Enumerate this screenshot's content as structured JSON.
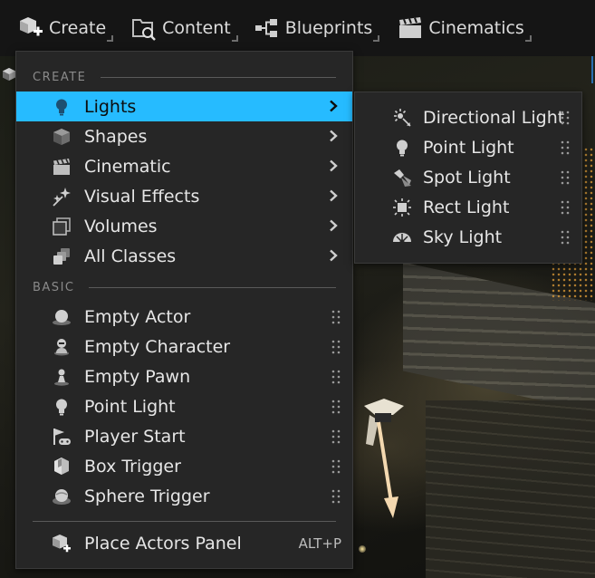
{
  "toolbar": {
    "items": [
      {
        "label": "Create",
        "icon": "create-actor-icon"
      },
      {
        "label": "Content",
        "icon": "content-browser-icon"
      },
      {
        "label": "Blueprints",
        "icon": "blueprints-icon"
      },
      {
        "label": "Cinematics",
        "icon": "clapperboard-icon"
      }
    ]
  },
  "menu": {
    "create_header": "CREATE",
    "basic_header": "BASIC",
    "create_items": [
      {
        "label": "Lights",
        "icon": "lightbulb-icon",
        "active": true
      },
      {
        "label": "Shapes",
        "icon": "cube-icon"
      },
      {
        "label": "Cinematic",
        "icon": "clapperboard-icon"
      },
      {
        "label": "Visual Effects",
        "icon": "sparkles-icon"
      },
      {
        "label": "Volumes",
        "icon": "volume-box-icon"
      },
      {
        "label": "All Classes",
        "icon": "stacked-classes-icon"
      }
    ],
    "basic_items": [
      {
        "label": "Empty Actor",
        "icon": "sphere-actor-icon"
      },
      {
        "label": "Empty Character",
        "icon": "character-icon"
      },
      {
        "label": "Empty Pawn",
        "icon": "pawn-icon"
      },
      {
        "label": "Point Light",
        "icon": "lightbulb-icon"
      },
      {
        "label": "Player Start",
        "icon": "flag-controller-icon"
      },
      {
        "label": "Box Trigger",
        "icon": "box-trigger-icon"
      },
      {
        "label": "Sphere Trigger",
        "icon": "sphere-trigger-icon"
      }
    ],
    "footer_item": {
      "label": "Place Actors Panel",
      "shortcut": "ALT+P",
      "icon": "place-actors-icon"
    }
  },
  "submenu": {
    "items": [
      {
        "label": "Directional Light",
        "icon": "directional-light-icon"
      },
      {
        "label": "Point Light",
        "icon": "lightbulb-icon"
      },
      {
        "label": "Spot Light",
        "icon": "spot-light-icon"
      },
      {
        "label": "Rect Light",
        "icon": "rect-light-icon"
      },
      {
        "label": "Sky Light",
        "icon": "sky-light-icon"
      }
    ]
  },
  "colors": {
    "accent": "#26bbff",
    "menu_bg": "#262626",
    "toolbar_bg": "#151515",
    "text": "#e6e6e6",
    "header_text": "#8a8a8a"
  }
}
